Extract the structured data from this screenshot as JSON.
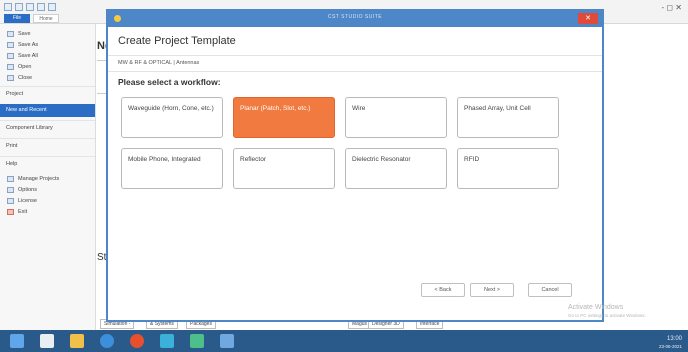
{
  "app": {
    "file_tab": "File",
    "home_tab": "Home",
    "window_controls": "- ◻ ✕"
  },
  "leftmenu": {
    "items": [
      "Save",
      "Save As",
      "Save All",
      "Open",
      "Close"
    ],
    "sections": [
      "Project",
      "New and Recent",
      "Component Library",
      "Print",
      "Help"
    ],
    "help_items": [
      "Manage Projects",
      "Options",
      "License",
      "Exit"
    ]
  },
  "background": {
    "new_label": "Ne",
    "start_label": "St"
  },
  "dialog": {
    "window_title": "CST STUDIO SUITE",
    "header": "Create Project Template",
    "breadcrumb": "MW & RF & OPTICAL | Antennas",
    "prompt": "Please select a workflow:",
    "workflows": [
      "Waveguide (Horn, Cone, etc.)",
      "Planar (Patch, Slot, etc.)",
      "Wire",
      "Phased Array, Unit Cell",
      "Mobile Phone, Integrated",
      "Reflector",
      "Dielectric Resonator",
      "RFID"
    ],
    "selected_index": 1,
    "back_label": "< Back",
    "next_label": "Next >",
    "cancel_label": "Cancel"
  },
  "bottom_tabs": [
    "Simulation -",
    "& Systems",
    "Packages",
    "Magus",
    "Designer 3D",
    "Interface"
  ],
  "activate": {
    "line1": "Activate Windows",
    "line2": "Go to PC settings to activate Windows."
  },
  "taskbar": {
    "time": "13:00",
    "date": "23-06-2021"
  },
  "colors": {
    "accent": "#4e87c7",
    "selected": "#f07a3f",
    "taskbar": "#2a5a8a"
  }
}
